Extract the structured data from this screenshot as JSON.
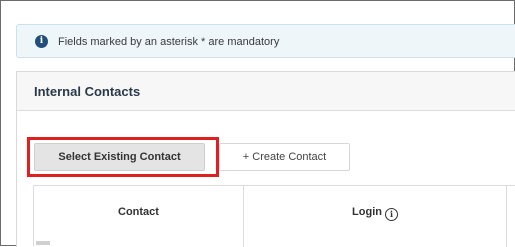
{
  "alert": {
    "icon": "info-icon",
    "text": "Fields marked by an asterisk * are mandatory",
    "background": "#eef6fa"
  },
  "panel": {
    "title": "Internal Contacts"
  },
  "actions": {
    "select_existing_label": "Select Existing Contact",
    "create_label": "+ Create Contact",
    "highlight_color": "#e02020"
  },
  "table": {
    "columns": [
      {
        "label": "Contact"
      },
      {
        "label": "Login",
        "icon": "info-icon"
      }
    ]
  }
}
